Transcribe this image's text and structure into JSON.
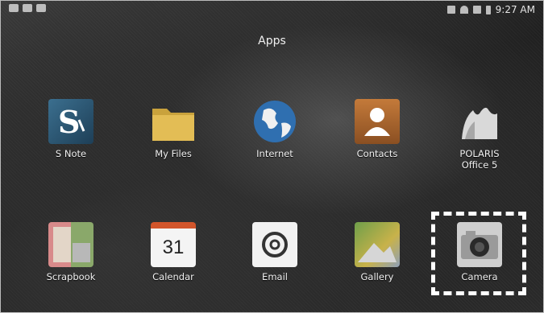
{
  "status_bar": {
    "time": "9:27 AM"
  },
  "header": {
    "title": "Apps"
  },
  "apps": [
    {
      "label": "S Note",
      "icon": "s-note-icon"
    },
    {
      "label": "My Files",
      "icon": "folder-icon"
    },
    {
      "label": "Internet",
      "icon": "globe-icon"
    },
    {
      "label": "Contacts",
      "icon": "contact-icon"
    },
    {
      "label": "POLARIS\nOffice 5",
      "icon": "polaris-icon"
    },
    {
      "label": "Scrapbook",
      "icon": "scrapbook-icon"
    },
    {
      "label": "Calendar",
      "icon": "calendar-icon",
      "day": "31"
    },
    {
      "label": "Email",
      "icon": "email-icon"
    },
    {
      "label": "Gallery",
      "icon": "gallery-icon"
    },
    {
      "label": "Camera",
      "icon": "camera-icon"
    }
  ],
  "colors": {
    "background": "#2a2a2a",
    "label_text": "#f2f2f2",
    "highlight": "#ffffff"
  }
}
